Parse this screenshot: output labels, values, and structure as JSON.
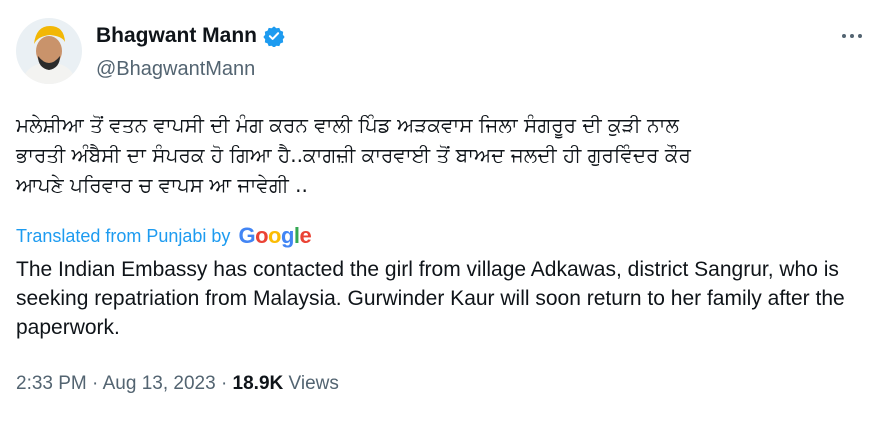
{
  "author": {
    "name": "Bhagwant Mann",
    "handle": "@BhagwantMann",
    "verified": true
  },
  "icons": {
    "avatar": "profile-photo",
    "verified": "verified-badge-icon",
    "more": "more-options-icon"
  },
  "colors": {
    "accent": "#1d9bf0",
    "secondary_text": "#536471",
    "primary_text": "#0f1419"
  },
  "tweet": {
    "original_lines": [
      "ਮਲੇਸ਼ੀਆ ਤੋਂ ਵਤਨ ਵਾਪਸੀ ਦੀ ਮੰਗ ਕਰਨ ਵਾਲੀ ਪਿੰਡ ਅੜਕਵਾਸ ਜਿਲਾ ਸੰਗਰੂਰ ਦੀ ਕੁੜੀ ਨਾਲ",
      "ਭਾਰਤੀ ਅੰਬੈਸੀ ਦਾ ਸੰਪਰਕ ਹੋ ਗਿਆ ਹੈ..ਕਾਗਜ਼ੀ ਕਾਰਵਾਈ ਤੋਂ ਬਾਅਦ ਜਲਦੀ ਹੀ ਗੁਰਵਿੰਦਰ ਕੌਰ",
      "ਆਪਣੇ ਪਰਿਵਾਰ ਚ ਵਾਪਸ ਆ ਜਾਵੇਗੀ .."
    ],
    "translated_label": "Translated from Punjabi by",
    "translation_provider": "Google",
    "translation": "The Indian Embassy has contacted the girl from village Adkawas, district Sangrur, who is seeking repatriation from Malaysia. Gurwinder Kaur will soon return to her family after the paperwork."
  },
  "meta": {
    "time": "2:33 PM",
    "separator": "·",
    "date": "Aug 13, 2023",
    "views_count": "18.9K",
    "views_label": "Views"
  }
}
